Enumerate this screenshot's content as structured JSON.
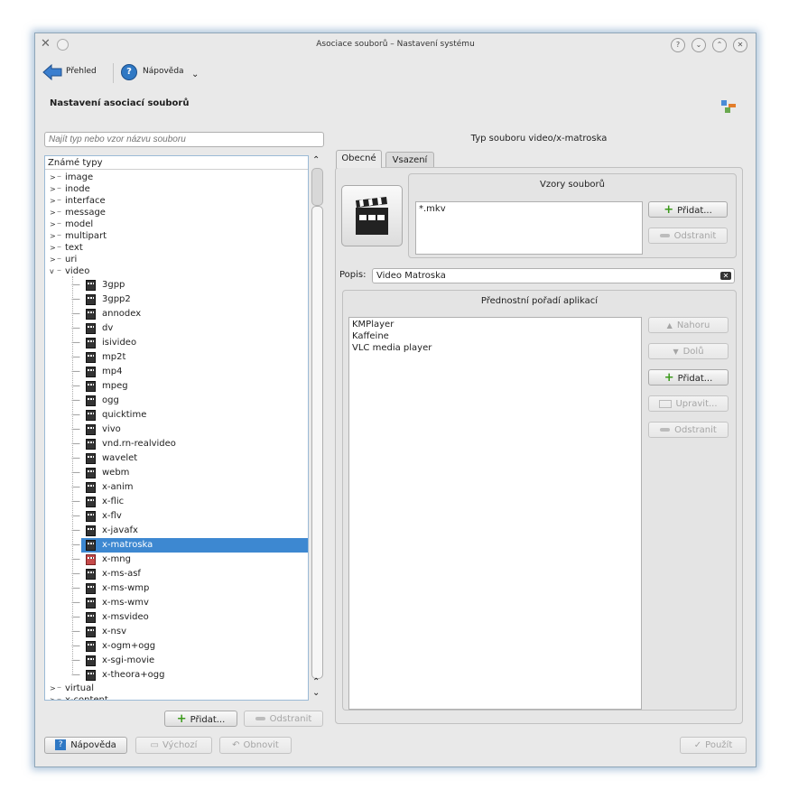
{
  "window": {
    "title": "Asociace souborů – Nastavení systému",
    "buttons": [
      "?",
      "⌄",
      "⌃",
      "✕"
    ]
  },
  "toolbar": {
    "overview_label": "Přehled",
    "help_label": "Nápověda",
    "help_arrow": "⌄"
  },
  "page": {
    "heading": "Nastavení asociací souborů"
  },
  "search": {
    "placeholder": "Najít typ nebo vzor názvu souboru"
  },
  "tree": {
    "header": "Známé typy",
    "top_items": [
      "image",
      "inode",
      "interface",
      "message",
      "model",
      "multipart",
      "text",
      "uri",
      "video"
    ],
    "video_children": [
      "3gpp",
      "3gpp2",
      "annodex",
      "dv",
      "isivideo",
      "mp2t",
      "mp4",
      "mpeg",
      "ogg",
      "quicktime",
      "vivo",
      "vnd.rn-realvideo",
      "wavelet",
      "webm",
      "x-anim",
      "x-flic",
      "x-flv",
      "x-javafx",
      "x-matroska",
      "x-mng",
      "x-ms-asf",
      "x-ms-wmp",
      "x-ms-wmv",
      "x-msvideo",
      "x-nsv",
      "x-ogm+ogg",
      "x-sgi-movie",
      "x-theora+ogg"
    ],
    "after_items": [
      "virtual",
      "x-content"
    ],
    "selected": "x-matroska",
    "expand_symbol": ">",
    "collapse_symbol": "v"
  },
  "left_buttons": {
    "add": "Přidat...",
    "remove": "Odstranit"
  },
  "right": {
    "mime_title": "Typ souboru video/x-matroska",
    "tabs": [
      "Obecné",
      "Vsazení"
    ],
    "patterns": {
      "title": "Vzory souborů",
      "items": [
        "*.mkv"
      ],
      "add": "Přidat...",
      "remove": "Odstranit"
    },
    "description": {
      "label": "Popis:",
      "value": "Video Matroska"
    },
    "apps": {
      "title": "Přednostní pořadí aplikací",
      "items": [
        "KMPlayer",
        "Kaffeine",
        "VLC media player"
      ],
      "up": "Nahoru",
      "down": "Dolů",
      "add": "Přidat...",
      "edit": "Upravit...",
      "remove": "Odstranit"
    }
  },
  "bottom": {
    "help": "Nápověda",
    "defaults": "Výchozí",
    "reset": "Obnovit",
    "apply": "Použít"
  }
}
